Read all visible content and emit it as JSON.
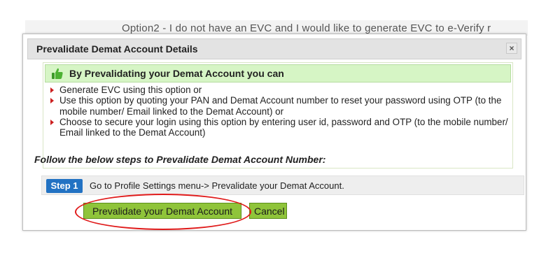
{
  "background": {
    "partial_text": "Option2 - I do not have an EVC and I would like to generate EVC to e-Verify r"
  },
  "dialog": {
    "title": "Prevalidate Demat Account Details",
    "close_label": "×"
  },
  "info": {
    "heading": "By Prevalidating your Demat Account you can",
    "bullets": [
      "Generate EVC using this option or",
      "Use this option by quoting your PAN and Demat Account number to reset your password using OTP (to the mobile number/ Email linked to the Demat Account) or",
      "Choose to secure your login using this option by entering user id, password and OTP (to the mobile number/ Email linked to the Demat Account)"
    ]
  },
  "steps": {
    "intro": "Follow the below steps to Prevalidate Demat Account Number:",
    "step1": {
      "badge": "Step 1",
      "text": "Go to Profile Settings menu-> Prevalidate your Demat Account."
    }
  },
  "actions": {
    "primary_label": "Prevalidate your Demat Account",
    "cancel_label": "Cancel"
  },
  "colors": {
    "accent_green": "#8fc43a",
    "info_header_bg": "#d6f5c5",
    "step_badge": "#2272c3",
    "highlight_red": "#e01b1b",
    "bullet_arrow": "#cc2020"
  },
  "icons": {
    "info_heading_icon": "thumbs-up-icon",
    "bullet_icon": "red-arrow-bullet-icon"
  }
}
